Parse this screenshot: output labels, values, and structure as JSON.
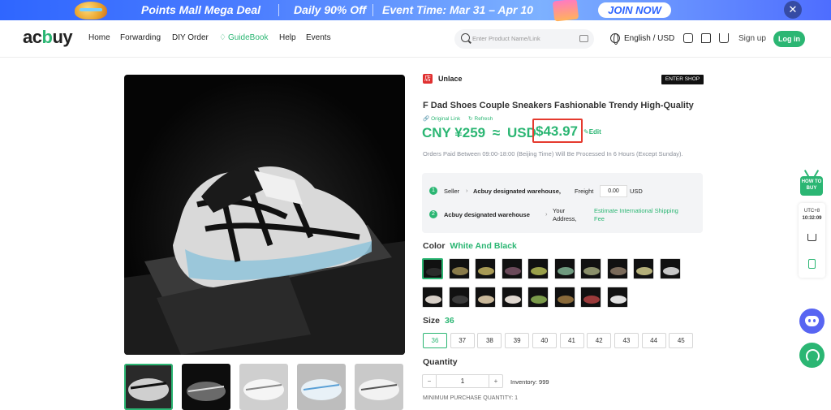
{
  "banner": {
    "title": "Points Mall Mega Deal",
    "offer": "Daily 90% Off",
    "event": "Event Time: Mar 31 – Apr 10",
    "join": "JOIN NOW",
    "close": "✕"
  },
  "header": {
    "logo_prefix": "ac",
    "logo_u": "b",
    "logo_suffix": "uy",
    "nav": [
      "Home",
      "Forwarding",
      "DIY Order",
      "GuideBook",
      "Help",
      "Events"
    ],
    "search_placeholder": "Enter Product Name/Link",
    "language": "English / USD",
    "signup": "Sign up",
    "login": "Log in"
  },
  "product": {
    "shop_name": "Unlace",
    "shop_logo": "店",
    "enter_shop": "ENTER SHOP",
    "title": "F Dad Shoes Couple Sneakers Fashionable Trendy High-Quality",
    "original_link": "Original Link",
    "refresh": "Refresh",
    "price_cny": "CNY ¥259",
    "approx": "≈",
    "usd_label": "USD",
    "price_usd": "$43.97",
    "edit": "Edit",
    "notice": "Orders Paid Between 09:00-18:00 (Beijing Time) Will Be Processed In 6 Hours (Except Sunday).",
    "shipping": {
      "step1": "1",
      "seller": "Seller",
      "warehouse_dest": "Acbuy designated warehouse,",
      "freight_label": "Freight",
      "freight_value": "0.00",
      "freight_currency": "USD",
      "step2": "2",
      "warehouse_src": "Acbuy designated warehouse",
      "your_address_1": "Your",
      "your_address_2": "Address,",
      "estimate_1": "Estimate International Shipping",
      "estimate_2": "Fee"
    },
    "color_label": "Color",
    "color_value": "White And Black",
    "size_label": "Size",
    "size_value": "36",
    "sizes": [
      "36",
      "37",
      "38",
      "39",
      "40",
      "41",
      "42",
      "43",
      "44",
      "45"
    ],
    "selected_size_index": 0,
    "quantity_label": "Quantity",
    "qty_minus": "−",
    "qty_value": "1",
    "qty_plus": "+",
    "inventory": "Inventory: 999",
    "min_qty": "MINIMUM PURCHASE QUANTITY: 1",
    "swatch_count": 18,
    "thumbnail_count": 5
  },
  "side": {
    "tv_text": "HOW TO BUY",
    "utc": "UTC+8",
    "time": "10:32:09"
  },
  "colors": {
    "accent": "#2bb673",
    "price_highlight_border": "#e53a2e",
    "banner_blue": "#2f66ff",
    "discord": "#5865f2"
  }
}
